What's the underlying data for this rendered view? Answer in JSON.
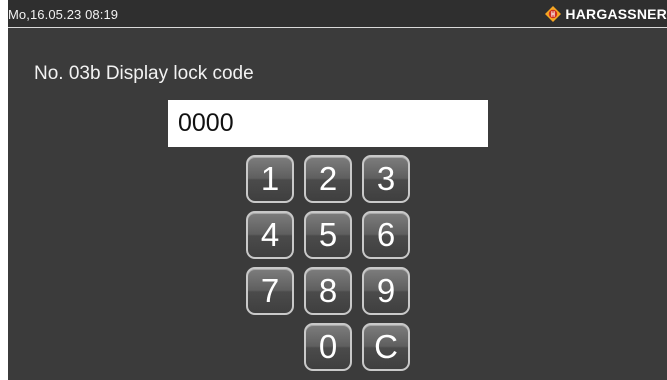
{
  "status_bar": {
    "datetime": "Mo,16.05.23 08:19",
    "brand": "HARGASSNER",
    "brand_icon": "hargassner-logo-icon",
    "brand_icon_color": "#f5a623"
  },
  "page": {
    "title": "No. 03b Display lock code"
  },
  "code_input": {
    "value": "0000"
  },
  "keypad": {
    "keys": [
      "1",
      "2",
      "3",
      "4",
      "5",
      "6",
      "7",
      "8",
      "9",
      "0",
      "C"
    ]
  },
  "colors": {
    "background": "#3b3b3b",
    "status_bar": "#2f2f2f",
    "text": "#f2f2f2",
    "input_bg": "#ffffff"
  }
}
